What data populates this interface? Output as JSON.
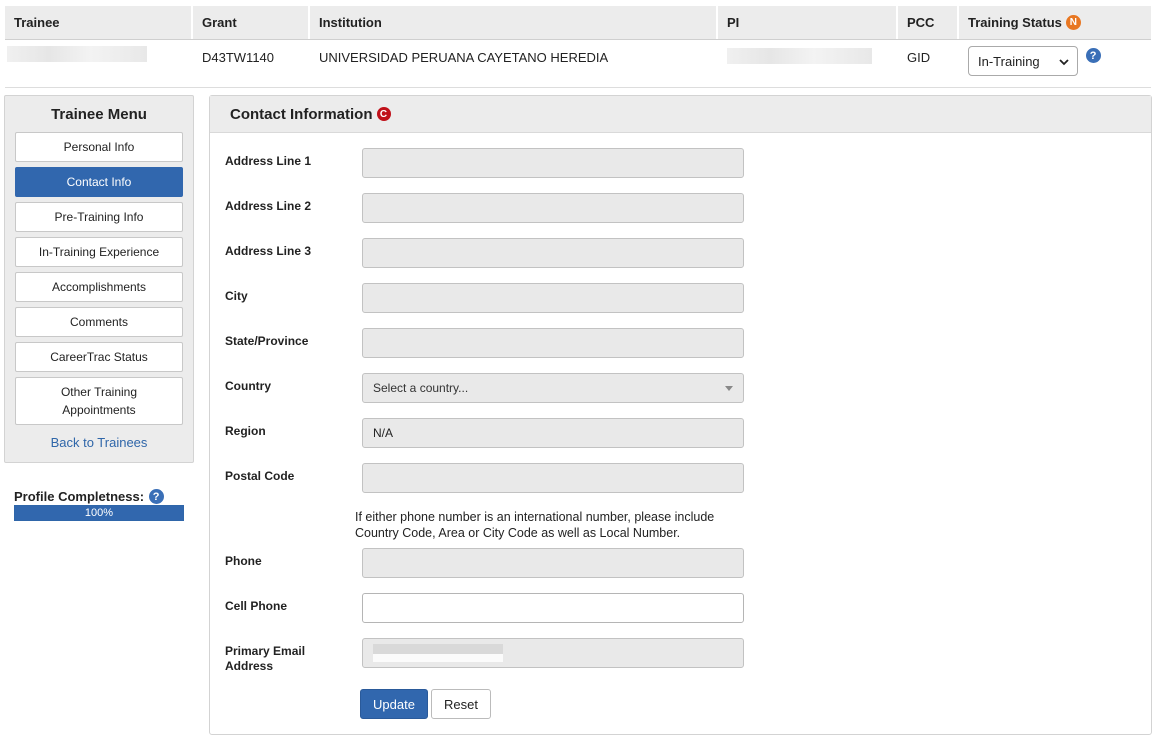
{
  "table": {
    "headers": {
      "trainee": "Trainee",
      "grant": "Grant",
      "institution": "Institution",
      "pi": "PI",
      "pcc": "PCC",
      "training_status": "Training Status",
      "status_badge": "N"
    },
    "row": {
      "grant": "D43TW1140",
      "institution": "UNIVERSIDAD PERUANA CAYETANO HEREDIA",
      "pcc": "GID",
      "training_status_value": "In-Training"
    }
  },
  "sidebar": {
    "title": "Trainee Menu",
    "items": [
      {
        "label": "Personal Info"
      },
      {
        "label": "Contact Info"
      },
      {
        "label": "Pre-Training Info"
      },
      {
        "label": "In-Training Experience"
      },
      {
        "label": "Accomplishments"
      },
      {
        "label": "Comments"
      },
      {
        "label": "CareerTrac Status"
      },
      {
        "label": "Other Training Appointments"
      }
    ],
    "active_item": "Contact Info",
    "back_link": "Back to Trainees",
    "completeness_label": "Profile Completness:",
    "completeness_value": "100%",
    "completeness_fraction": 1.0
  },
  "panel": {
    "title": "Contact Information",
    "title_badge": "C",
    "fields": {
      "address1": {
        "label": "Address Line 1",
        "value": ""
      },
      "address2": {
        "label": "Address Line 2",
        "value": ""
      },
      "address3": {
        "label": "Address Line 3",
        "value": ""
      },
      "city": {
        "label": "City",
        "value": ""
      },
      "state": {
        "label": "State/Province",
        "value": ""
      },
      "country": {
        "label": "Country",
        "value": "Select a country..."
      },
      "region": {
        "label": "Region",
        "value": "N/A"
      },
      "postal": {
        "label": "Postal Code",
        "value": ""
      },
      "phone": {
        "label": "Phone",
        "value": ""
      },
      "cell": {
        "label": "Cell Phone",
        "value": ""
      },
      "email": {
        "label": "Primary Email Address",
        "value": ""
      }
    },
    "phone_note": "If either phone number is an international number, please include Country Code, Area or City Code as well as Local Number.",
    "buttons": {
      "update": "Update",
      "reset": "Reset"
    }
  },
  "colors": {
    "accent": "#3167ae",
    "badge_orange": "#e87722",
    "badge_red": "#c0111a",
    "panel_header": "#ececec"
  }
}
